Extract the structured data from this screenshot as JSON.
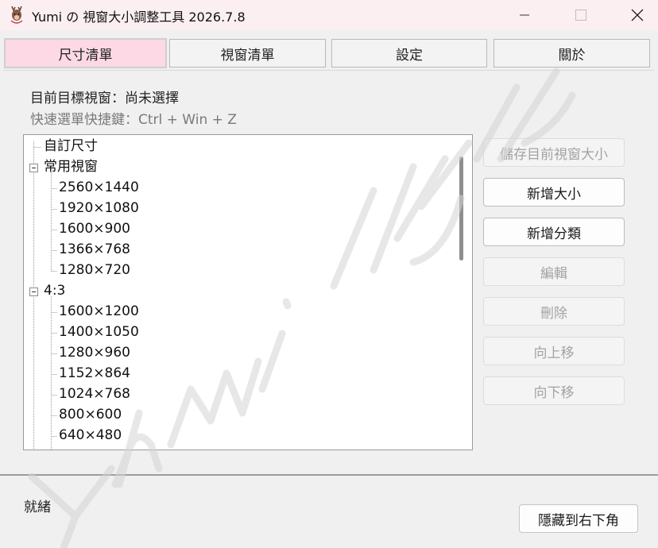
{
  "window": {
    "title": "Yumi の 視窗大小調整工具 2026.7.8",
    "icon": "deer-icon"
  },
  "tabs": [
    {
      "label": "尺寸清單",
      "active": true
    },
    {
      "label": "視窗清單",
      "active": false
    },
    {
      "label": "設定",
      "active": false
    },
    {
      "label": "關於",
      "active": false
    }
  ],
  "info": {
    "current_target": "目前目標視窗：尚未選擇",
    "hotkey_hint": "快速選單快捷鍵：Ctrl + Win + Z"
  },
  "tree": {
    "items": [
      {
        "label": "自訂尺寸",
        "level": 0,
        "expandable": false
      },
      {
        "label": "常用視窗",
        "level": 0,
        "expandable": true
      },
      {
        "label": "2560×1440",
        "level": 1
      },
      {
        "label": "1920×1080",
        "level": 1
      },
      {
        "label": "1600×900",
        "level": 1
      },
      {
        "label": "1366×768",
        "level": 1
      },
      {
        "label": "1280×720",
        "level": 1
      },
      {
        "label": "4:3",
        "level": 0,
        "expandable": true
      },
      {
        "label": "1600×1200",
        "level": 1
      },
      {
        "label": "1400×1050",
        "level": 1
      },
      {
        "label": "1280×960",
        "level": 1
      },
      {
        "label": "1152×864",
        "level": 1
      },
      {
        "label": "1024×768",
        "level": 1
      },
      {
        "label": "800×600",
        "level": 1
      },
      {
        "label": "640×480",
        "level": 1
      }
    ]
  },
  "actions": [
    {
      "label": "儲存目前視窗大小",
      "enabled": false
    },
    {
      "label": "新增大小",
      "enabled": true
    },
    {
      "label": "新增分類",
      "enabled": true
    },
    {
      "label": "編輯",
      "enabled": false
    },
    {
      "label": "刪除",
      "enabled": false
    },
    {
      "label": "向上移",
      "enabled": false
    },
    {
      "label": "向下移",
      "enabled": false
    }
  ],
  "status": {
    "text": "就緒",
    "hide_button": "隱藏到右下角"
  },
  "colors": {
    "titlebar": "#fbeff2",
    "active_tab": "#fcd9e4",
    "background": "#f0f0f0"
  }
}
